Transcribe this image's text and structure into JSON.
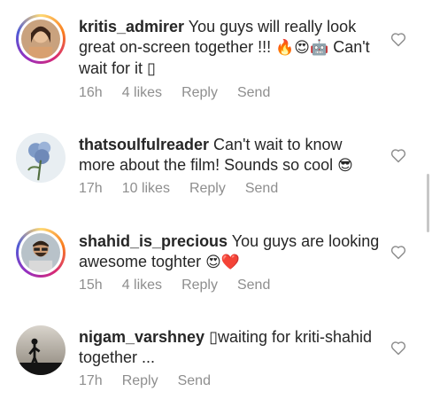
{
  "comments": [
    {
      "username": "kritis_admirer",
      "text": "You guys will really look great on-screen together !!!",
      "emojis": "🔥😍🤖",
      "text2": "Can't wait for it",
      "trailing_glyph": "▯",
      "time": "16h",
      "likes": "4 likes",
      "reply": "Reply",
      "send": "Send"
    },
    {
      "username": "thatsoulfulreader",
      "text": "Can't wait to know more about the film! Sounds so cool",
      "emojis": "😎",
      "time": "17h",
      "likes": "10 likes",
      "reply": "Reply",
      "send": "Send"
    },
    {
      "username": "shahid_is_precious",
      "text": "You guys are looking awesome toghter",
      "emojis": "😍❤️",
      "time": "15h",
      "likes": "4 likes",
      "reply": "Reply",
      "send": "Send"
    },
    {
      "username": "nigam_varshney",
      "lead_glyph": "▯",
      "text": "waiting for kriti-shahid together ...",
      "time": "17h",
      "reply": "Reply",
      "send": "Send"
    }
  ],
  "icons": {
    "like": "heart-outline-icon"
  },
  "colors": {
    "text": "#262626",
    "meta": "#8e8e8e",
    "heart_stroke": "#8e8e8e"
  }
}
